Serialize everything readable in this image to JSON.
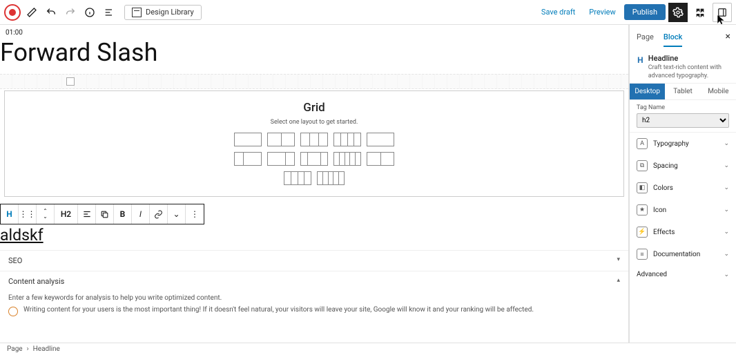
{
  "topbar": {
    "design_library": "Design Library",
    "save_draft": "Save draft",
    "preview": "Preview",
    "publish": "Publish"
  },
  "editor": {
    "time": "01:00",
    "page_title": "Forward Slash",
    "grid": {
      "title": "Grid",
      "subtitle": "Select one layout to get started."
    },
    "toolbar": {
      "h": "H",
      "h2": "H2",
      "bold": "B",
      "italic": "I"
    },
    "h2_text": "aldskf",
    "seo_label": "SEO",
    "content_analysis_label": "Content analysis",
    "content_hint": "Enter a few keywords for analysis to help you write optimized content.",
    "content_tip": "Writing content for your users is the most important thing! If it doesn't feel natural, your visitors will leave your site, Google will know it and your ranking will be affected."
  },
  "sidebar": {
    "tabs": {
      "page": "Page",
      "block": "Block"
    },
    "block": {
      "name": "Headline",
      "desc": "Craft text-rich content with advanced typography."
    },
    "devices": {
      "desktop": "Desktop",
      "tablet": "Tablet",
      "mobile": "Mobile"
    },
    "tag_label": "Tag Name",
    "tag_value": "h2",
    "panels": {
      "typography": "Typography",
      "spacing": "Spacing",
      "colors": "Colors",
      "icon": "Icon",
      "effects": "Effects",
      "documentation": "Documentation",
      "advanced": "Advanced"
    }
  },
  "footer": {
    "page": "Page",
    "sep": "›",
    "block": "Headline"
  }
}
